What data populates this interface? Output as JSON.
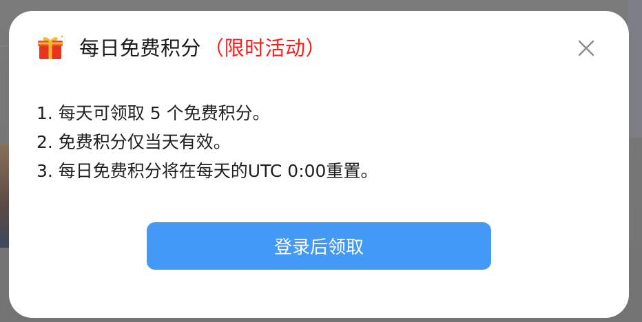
{
  "modal": {
    "title": "每日免费积分",
    "tag": "（限时活动）",
    "gift_icon": "gift-icon",
    "close_icon": "close-icon",
    "rules": [
      "1. 每天可领取 5 个免费积分。",
      "2. 免费积分仅当天有效。",
      "3. 每日免费积分将在每天的UTC 0:00重置。"
    ],
    "login_button": "登录后领取"
  },
  "colors": {
    "accent": "#4299f6",
    "tag_red": "#ff1a1a",
    "modal_bg": "#ffffff",
    "backdrop": "#747474"
  }
}
